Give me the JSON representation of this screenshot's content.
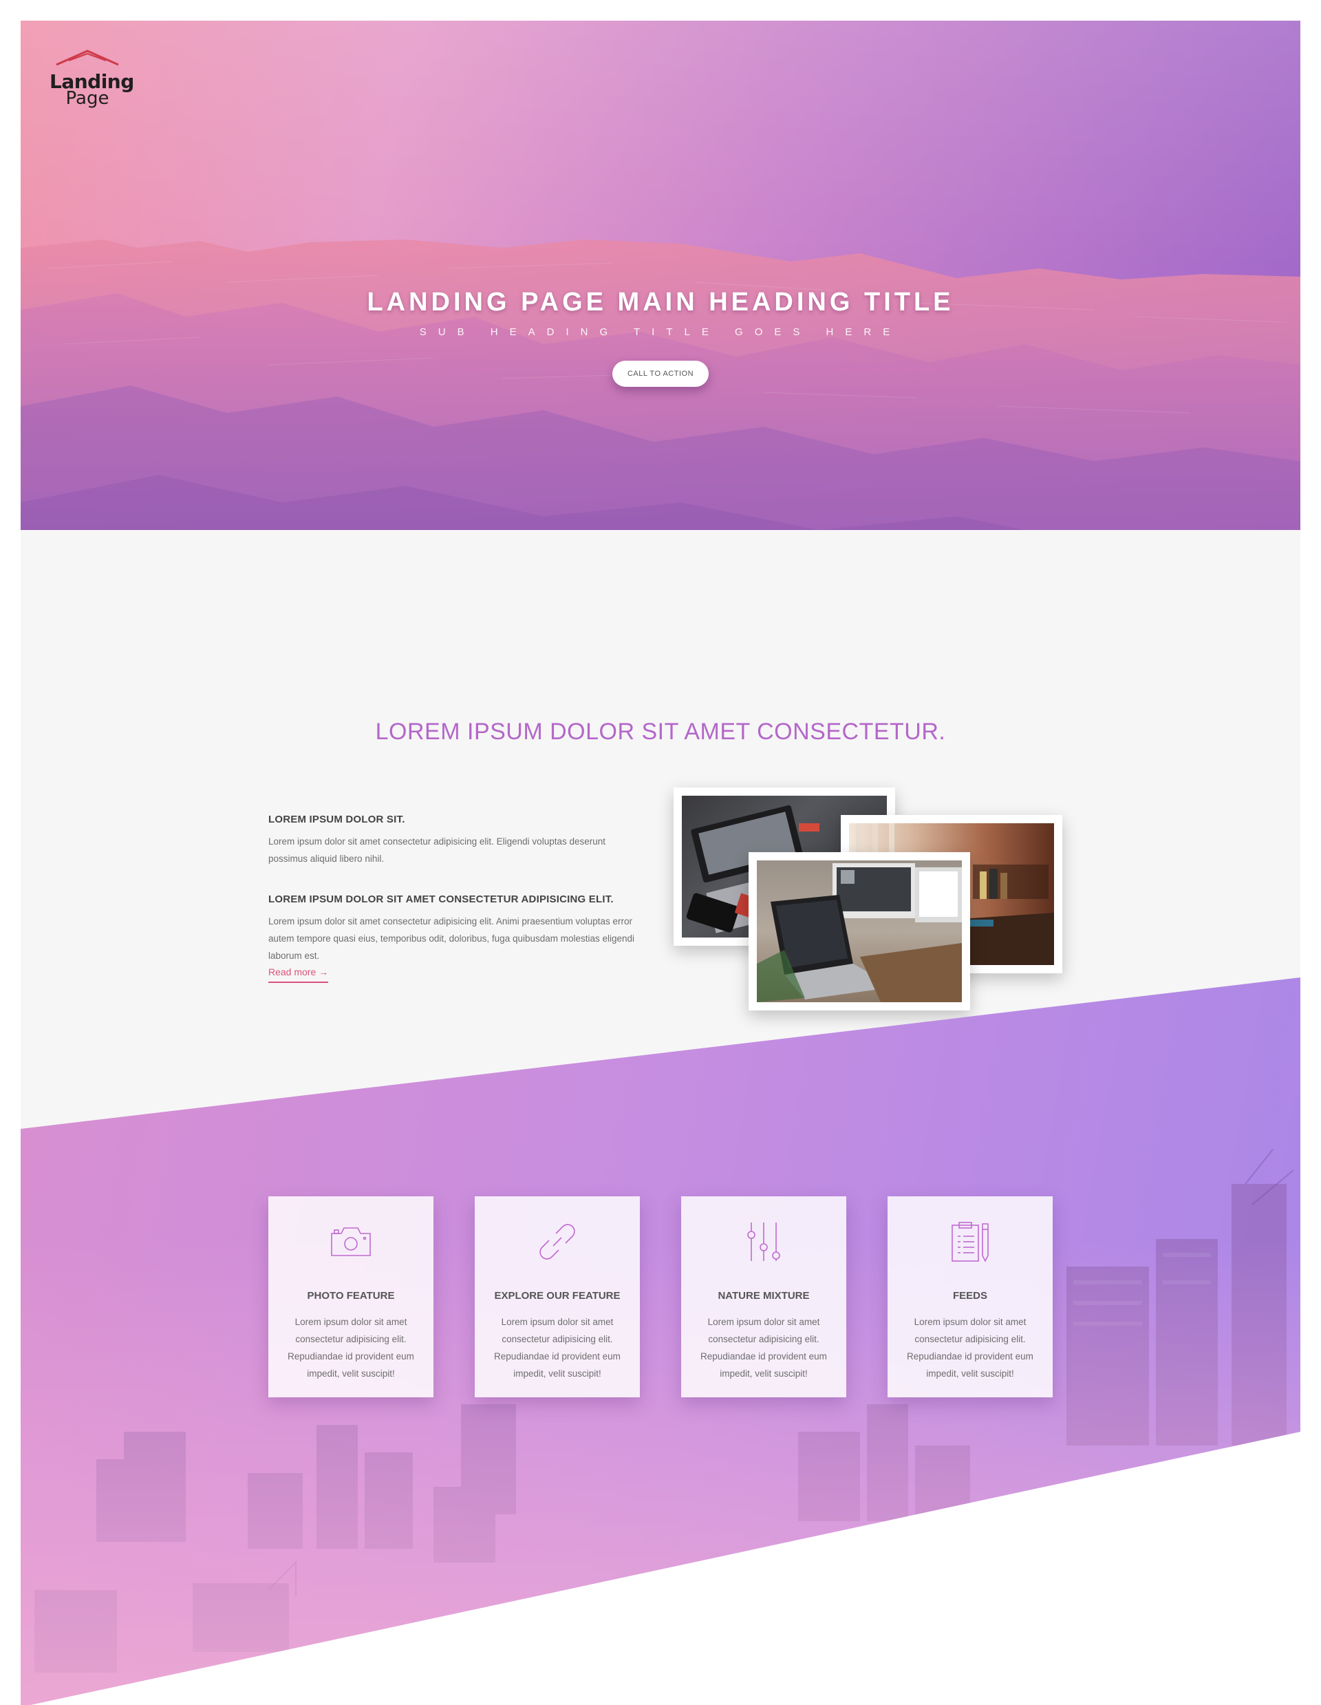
{
  "brand": {
    "logo_line1": "Landing",
    "logo_line2": "Page"
  },
  "hero": {
    "title": "LANDING PAGE MAIN HEADING TITLE",
    "subtitle": "SUB HEADING TITLE GOES HERE",
    "cta_label": "CALL TO ACTION"
  },
  "about": {
    "title": "LOREM IPSUM DOLOR SIT AMET CONSECTETUR.",
    "blocks": [
      {
        "heading": "LOREM IPSUM DOLOR SIT.",
        "text": "Lorem ipsum dolor sit amet consectetur adipisicing elit. Eligendi voluptas deserunt possimus aliquid libero nihil."
      },
      {
        "heading": "LOREM IPSUM DOLOR SIT AMET CONSECTETUR ADIPISICING ELIT.",
        "text": "Lorem ipsum dolor sit amet consectetur adipisicing elit. Animi praesentium voluptas error autem tempore quasi eius, temporibus odit, doloribus, fuga quibusdam molestias eligendi laborum est."
      }
    ],
    "read_more": "Read more →"
  },
  "features": [
    {
      "icon": "camera-icon",
      "title": "PHOTO FEATURE",
      "text": "Lorem ipsum dolor sit amet consectetur adipisicing elit. Repudiandae id provident eum impedit, velit suscipit!"
    },
    {
      "icon": "link-icon",
      "title": "EXPLORE OUR FEATURE",
      "text": "Lorem ipsum dolor sit amet consectetur adipisicing elit. Repudiandae id provident eum impedit, velit suscipit!"
    },
    {
      "icon": "sliders-icon",
      "title": "NATURE MIXTURE",
      "text": "Lorem ipsum dolor sit amet consectetur adipisicing elit. Repudiandae id provident eum impedit, velit suscipit!"
    },
    {
      "icon": "clipboard-icon",
      "title": "FEEDS",
      "text": "Lorem ipsum dolor sit amet consectetur adipisicing elit. Repudiandae id provident eum impedit, velit suscipit!"
    }
  ],
  "colors": {
    "accent_pink": "#d9537b",
    "accent_purple": "#b467c9",
    "hero_start": "#ef93ac",
    "hero_end": "#9e66c9",
    "feature_start": "#d88fd1",
    "feature_end": "#a986e8"
  }
}
